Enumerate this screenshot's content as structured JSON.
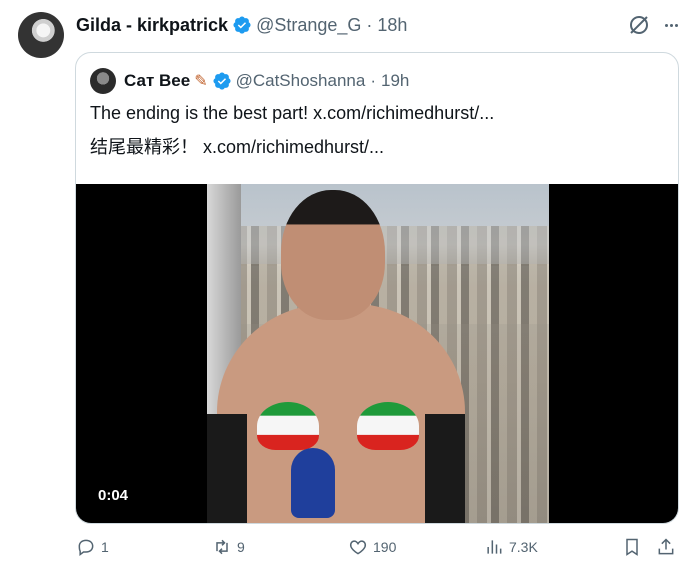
{
  "tweet": {
    "author_name": "Gilda - kirkpatrick",
    "author_handle": "@Strange_G",
    "separator": "·",
    "time": "18h"
  },
  "quoted_tweet": {
    "author_name": "Сат Вее",
    "author_handle": "@CatShoshanna",
    "separator": "·",
    "time": "19h",
    "line1_text": "The ending is the best part!",
    "line1_link": "x.com/richimedhurst/...",
    "line2_text": "结尾最精彩！",
    "line2_link": "x.com/richimedhurst/...",
    "video_duration": "0:04"
  },
  "actions": {
    "replies": "1",
    "reposts": "9",
    "likes": "190",
    "views": "7.3K"
  },
  "colors": {
    "verified": "#1d9bf0",
    "secondary_text": "#536471",
    "border": "#cfd9de"
  }
}
